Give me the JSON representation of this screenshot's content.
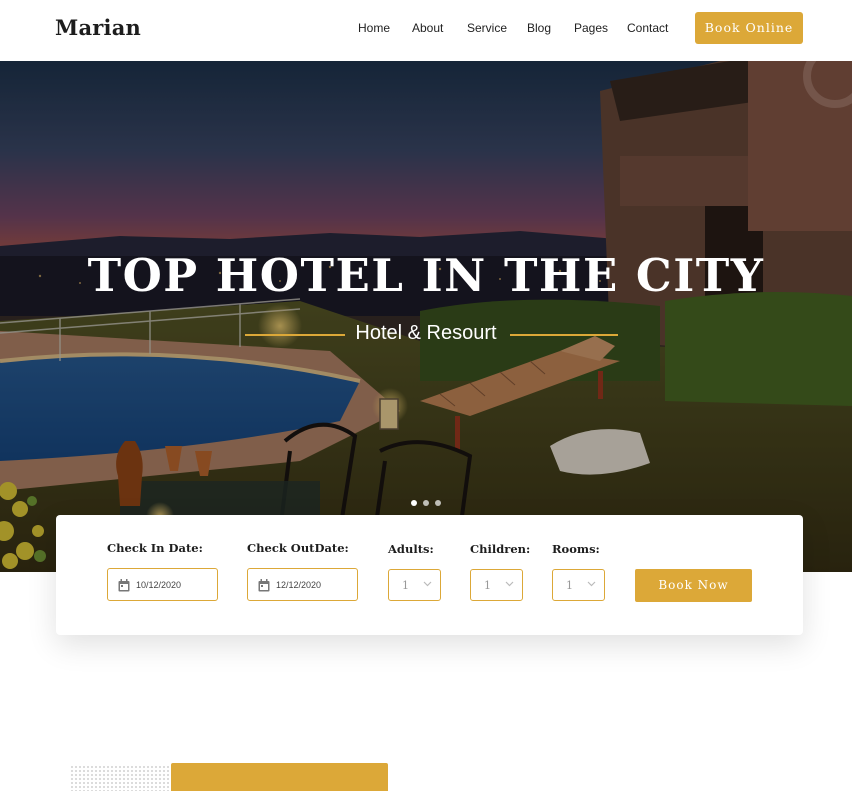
{
  "brand": {
    "logo": "Marian",
    "accent_color": "#dca838"
  },
  "nav": {
    "items": [
      {
        "label": "Home"
      },
      {
        "label": "About"
      },
      {
        "label": "Service"
      },
      {
        "label": "Blog"
      },
      {
        "label": "Pages"
      },
      {
        "label": "Contact"
      }
    ],
    "cta_label": "Book Online"
  },
  "hero": {
    "title": "TOP HOTEL IN THE CITY",
    "subtitle": "Hotel & Resourt",
    "slides": {
      "count": 3,
      "active": 1
    }
  },
  "booking": {
    "check_in": {
      "label": "Check In Date:",
      "value": "10/12/2020",
      "icon": "calendar-icon"
    },
    "check_out": {
      "label": "Check OutDate:",
      "value": "12/12/2020",
      "icon": "calendar-icon"
    },
    "adults": {
      "label": "Adults:",
      "value": "1"
    },
    "children": {
      "label": "Children:",
      "value": "1"
    },
    "rooms": {
      "label": "Rooms:",
      "value": "1"
    },
    "submit_label": "Book Now"
  }
}
